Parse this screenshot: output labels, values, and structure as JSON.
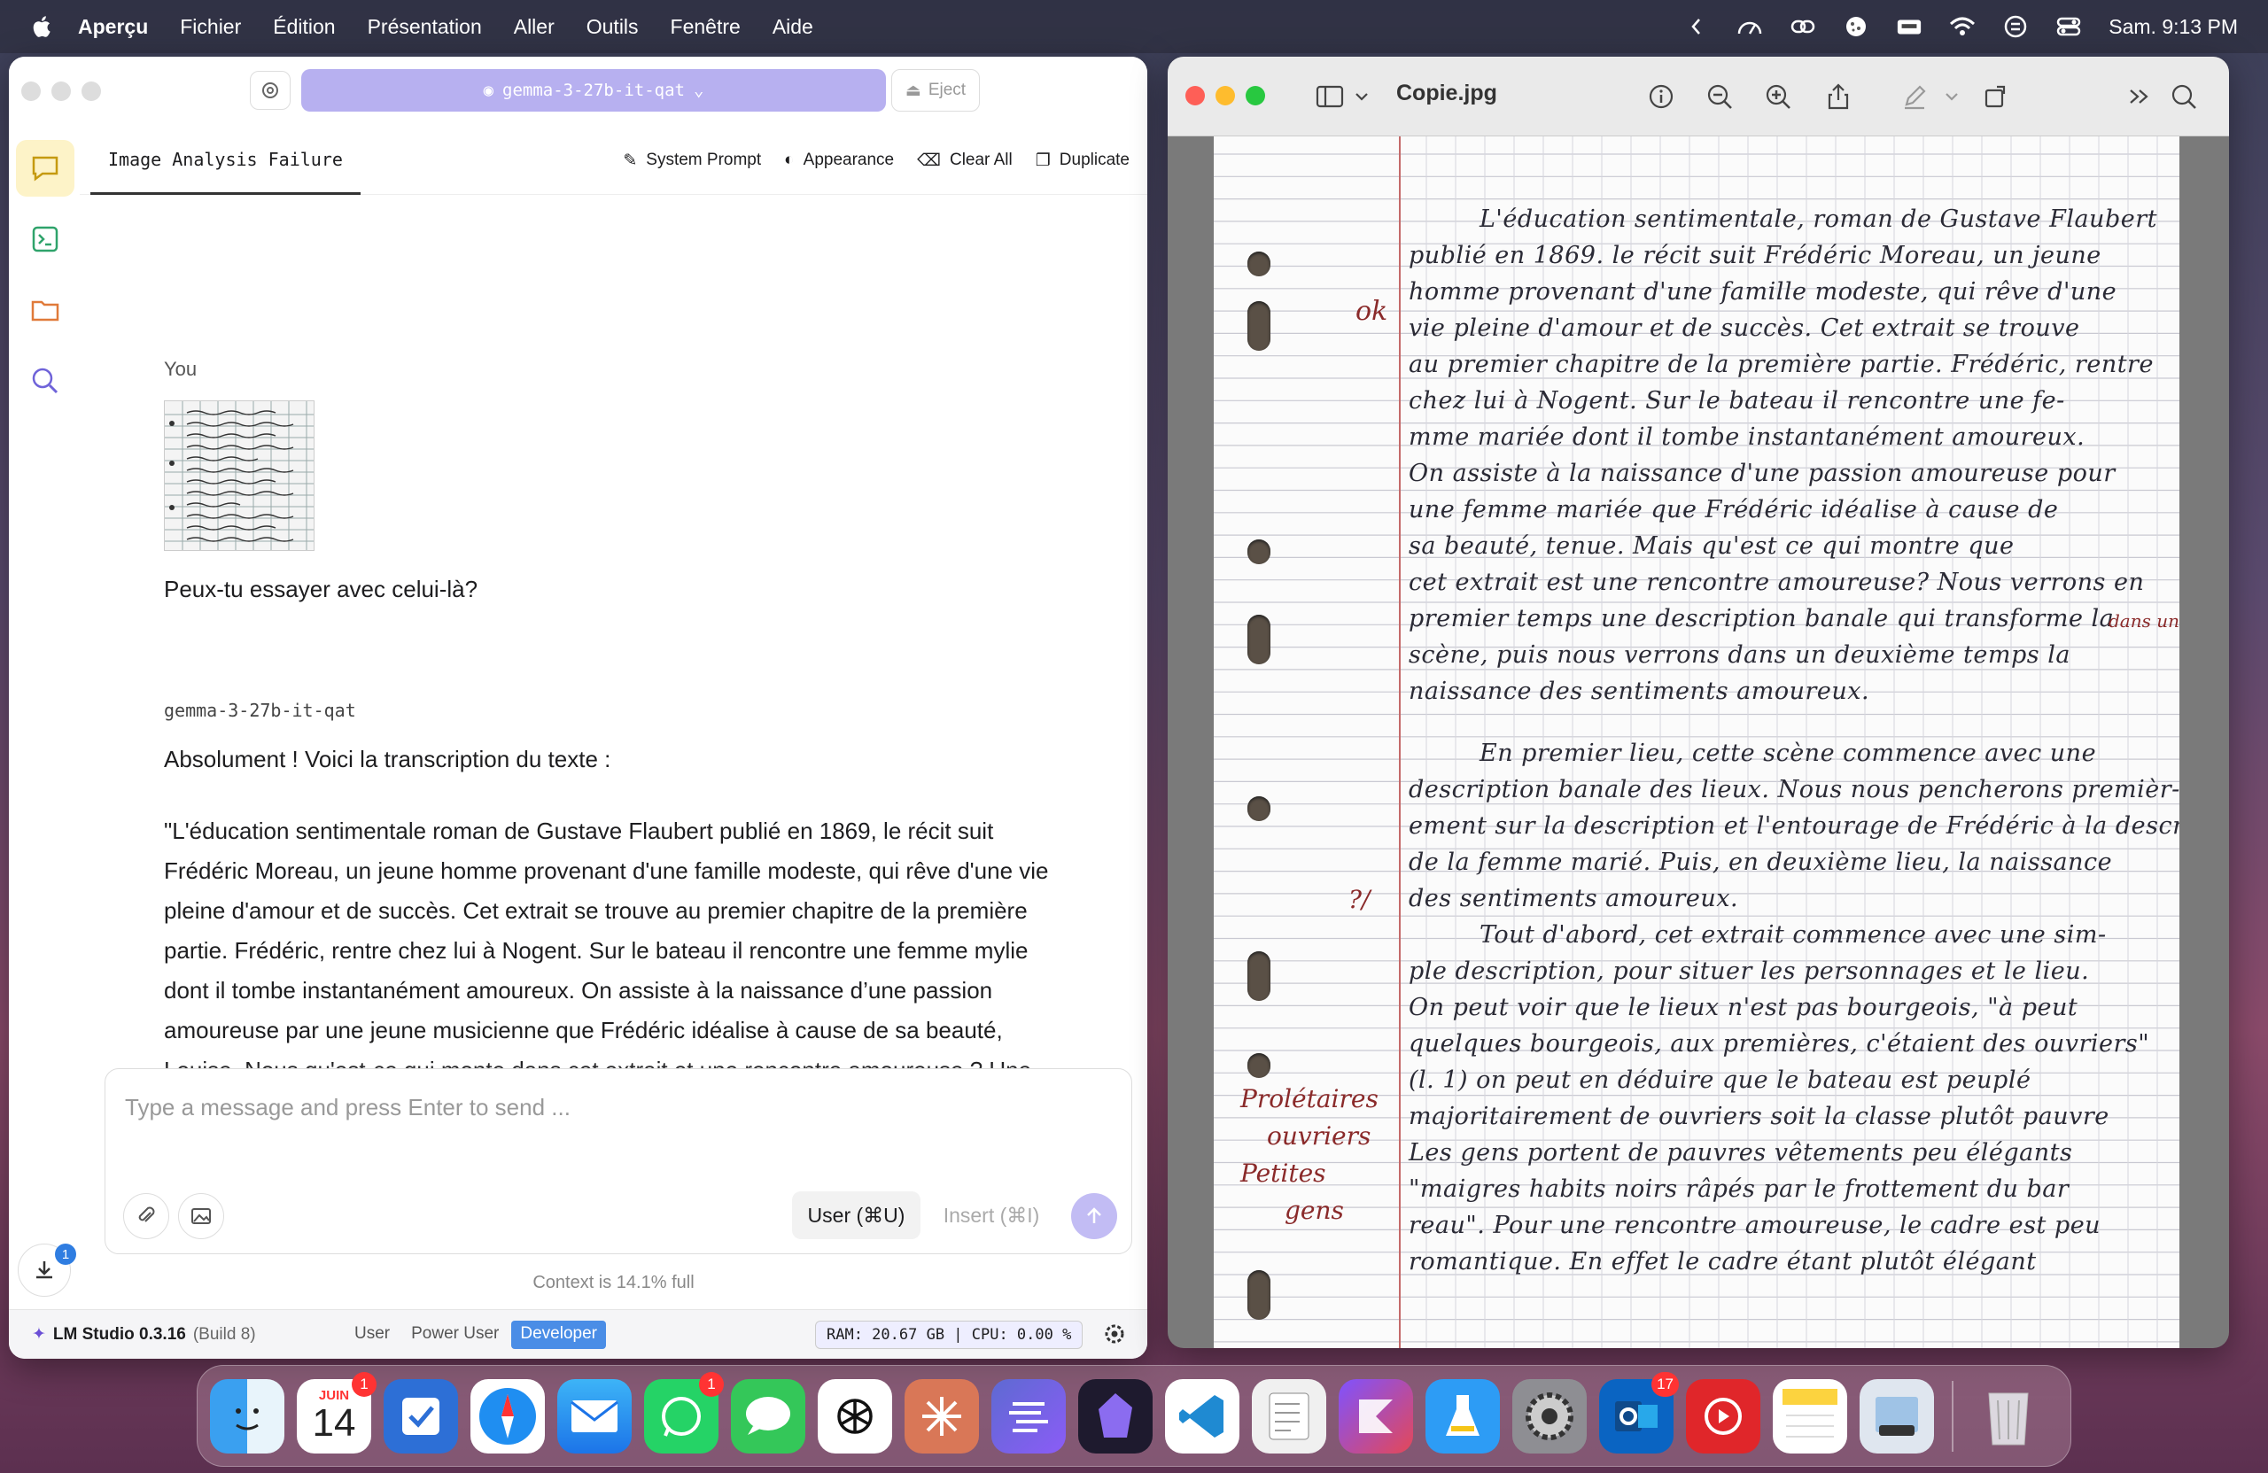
{
  "menubar": {
    "app_name": "Aperçu",
    "items": [
      "Fichier",
      "Édition",
      "Présentation",
      "Aller",
      "Outils",
      "Fenêtre",
      "Aide"
    ],
    "clock": "Sam. 9:13 PM"
  },
  "lmstudio": {
    "model_selector": "gemma-3-27b-it-qat",
    "eject_label": "Eject",
    "chat_tab": "Image Analysis Failure",
    "tools": {
      "system_prompt": "System Prompt",
      "appearance": "Appearance",
      "clear_all": "Clear All",
      "duplicate": "Duplicate"
    },
    "conversation": {
      "user_label": "You",
      "user_message": "Peux-tu essayer avec celui-là?",
      "model_label": "gemma-3-27b-it-qat",
      "response_intro": "Absolument ! Voici la transcription du texte :",
      "response_body": "\"L'éducation sentimentale roman de Gustave Flaubert publié en 1869, le récit suit Frédéric Moreau, un jeune homme provenant d'une famille modeste, qui rêve d'une vie pleine d'amour et de succès. Cet extrait se trouve au premier chapitre de la première partie. Frédéric, rentre chez lui à Nogent. Sur le bateau il rencontre une femme mylie dont il tombe instantanément amoureux. On assiste à la naissance d’une passion amoureuse par une jeune musicienne que Frédéric idéalise à cause de sa beauté, Louise. Nous qu'est-ce qui monte dans cet extrait et une rencontre amoureuse ? Une narration se prolonge longtemps avec des détails qui transforme"
    },
    "composer": {
      "placeholder": "Type a message and press Enter to send ...",
      "user_button": "User (⌘U)",
      "insert_button": "Insert (⌘I)"
    },
    "context_text": "Context is 14.1% full",
    "downloads_badge": "1",
    "status": {
      "brand": "LM Studio 0.3.16",
      "build": "(Build 8)",
      "modes": [
        "User",
        "Power User",
        "Developer"
      ],
      "active_mode": "Developer",
      "sysinfo": "RAM: 20.67 GB | CPU: 0.00 %"
    }
  },
  "preview": {
    "filename": "Copie.jpg",
    "lines": [
      "L'éducation sentimentale, roman de Gustave Flaubert",
      "publié en 1869. le récit suit Frédéric Moreau, un jeune",
      "homme provenant d'une famille modeste, qui rêve d'une",
      "vie pleine d'amour et de succès. Cet extrait se trouve",
      "au premier chapitre de la première partie. Frédéric, rentre",
      "chez lui à Nogent. Sur le bateau il rencontre une fe-",
      "mme mariée dont il tombe instantanément amoureux.",
      "On assiste à la naissance d'une passion amoureuse pour",
      "une femme mariée que Frédéric idéalise à cause de",
      "sa beauté, tenue. Mais qu'est ce qui montre que",
      "cet extrait est une rencontre amoureuse? Nous verrons en",
      "premier temps une description banale qui transforme la",
      "scène, puis nous verrons dans un deuxième temps la",
      "naissance des sentiments amoureux.",
      "",
      "En premier lieu, cette scène commence avec une",
      "description banale des lieux. Nous nous pencherons premièr-",
      "ement sur la description et l'entourage de Frédéric à la description",
      "de la femme marié. Puis, en deuxième lieu, la naissance",
      "des sentiments amoureux.",
      "Tout d'abord, cet extrait commence avec une sim-",
      "ple description, pour situer les personnages et le lieu.",
      "On peut voir que le lieux n'est pas bourgeois, \"à peut",
      "quelques bourgeois, aux premières, c'étaient des ouvriers\"",
      "(l. 1) on peut en déduire que le bateau est peuplé",
      "majoritairement de ouvriers soit la classe plutôt pauvre",
      "Les gens portent de pauvres vêtements peu élégants",
      "\"maigres habits noirs râpés par le frottement du bar",
      "reau\". Pour une rencontre amoureuse, le cadre est peu",
      "romantique. En effet le cadre étant plutôt élégant"
    ],
    "margin_notes": [
      "ok",
      "dans un",
      "Prolétaires",
      "ouvriers",
      "Petites",
      "gens",
      "?/"
    ]
  },
  "dock": {
    "calendar_month": "JUIN",
    "calendar_day": "14",
    "badges": {
      "calendar": "1",
      "whatsapp": "1",
      "outlook": "17"
    },
    "apps": [
      "finder-icon",
      "calendar-icon",
      "reminders-icon",
      "safari-icon",
      "mail-icon",
      "whatsapp-icon",
      "messages-icon",
      "chatgpt-icon",
      "claude-icon",
      "linear-icon",
      "obsidian-icon",
      "vscode-icon",
      "notes-toolbar-icon",
      "kotlin-icon",
      "testflight-icon",
      "system-settings-icon",
      "outlook-icon",
      "pdf-icon",
      "notes-icon",
      "preview-icon",
      "trash-icon"
    ]
  }
}
